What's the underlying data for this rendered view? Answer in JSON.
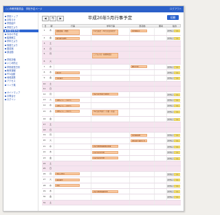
{
  "topbar": {
    "title": "○○市教育委員会　学校予定ページ",
    "right": "ログアウト"
  },
  "sidebar": {
    "groups": [
      {
        "items": [
          {
            "label": "学校トップ"
          },
          {
            "label": "お知らせ"
          },
          {
            "label": "学校紹介"
          },
          {
            "label": "学校だより"
          },
          {
            "label": "年間行事予定",
            "active": true
          },
          {
            "label": "今月の予定"
          },
          {
            "label": "給食献立"
          },
          {
            "label": "学年だより"
          },
          {
            "label": "保健だより"
          },
          {
            "label": "図書館"
          },
          {
            "label": "部活動"
          }
        ]
      },
      {
        "items": [
          {
            "label": "学校評価"
          },
          {
            "label": "いじめ防止"
          },
          {
            "label": "学校経営方針"
          },
          {
            "label": "教育課程"
          },
          {
            "label": "PTA活動"
          },
          {
            "label": "地域連携"
          },
          {
            "label": "アクセス"
          },
          {
            "label": "リンク集"
          }
        ]
      },
      {
        "items": [
          {
            "label": "サイトマップ"
          },
          {
            "label": "お問合せ"
          },
          {
            "label": "ログイン"
          }
        ]
      }
    ]
  },
  "nav": {
    "prev": "◀",
    "today": "今",
    "next": "▶"
  },
  "title": "平成26年5月行事予定",
  "print_button": "印刷",
  "columns": [
    "日",
    "曜",
    "行事",
    "学年行事",
    "部活動",
    "備考",
    "給食"
  ],
  "rows": [
    {
      "day": "1",
      "dow": "木",
      "type": "weekday",
      "events": [
        {
          "col": 2,
          "text": "避難訓練（地震）",
          "lines": 2
        },
        {
          "col": 3,
          "text": "1年生遠足・2年生社会科見学",
          "lines": 2
        },
        {
          "col": 4,
          "text": "部活動停止"
        }
      ],
      "tags": [
        {
          "col": 6,
          "text": "給食あり",
          "style": "g"
        },
        {
          "col": 6,
          "text": "牛乳",
          "style": "y",
          "offset": 1
        }
      ]
    },
    {
      "day": "2",
      "dow": "金",
      "type": "weekday",
      "events": [
        {
          "col": 2,
          "text": "教育相談週間"
        }
      ],
      "tags": [
        {
          "col": 6,
          "text": "給食あり",
          "style": "g"
        },
        {
          "col": 6,
          "text": "牛乳",
          "style": "y",
          "offset": 1
        }
      ]
    },
    {
      "day": "3",
      "dow": "土",
      "type": "weekend",
      "events": [],
      "tags": []
    },
    {
      "day": "4",
      "dow": "日",
      "type": "weekend",
      "events": [],
      "tags": []
    },
    {
      "day": "5",
      "dow": "月",
      "type": "weekend",
      "events": [
        {
          "col": 3,
          "text": "こどもの日・振替休業日",
          "lines": 2
        }
      ],
      "tags": []
    },
    {
      "day": "6",
      "dow": "火",
      "type": "weekend",
      "events": [],
      "tags": []
    },
    {
      "day": "7",
      "dow": "水",
      "type": "weekday",
      "events": [
        {
          "col": 4,
          "text": "職員会議"
        }
      ],
      "tags": [
        {
          "col": 6,
          "text": "給食あり",
          "style": "g"
        },
        {
          "col": 6,
          "text": "牛乳",
          "style": "y",
          "offset": 1
        }
      ]
    },
    {
      "day": "8",
      "dow": "木",
      "type": "weekday",
      "events": [
        {
          "col": 2,
          "text": "委員会"
        }
      ],
      "tags": [
        {
          "col": 6,
          "text": "給食あり",
          "style": "g"
        },
        {
          "col": 6,
          "text": "牛乳",
          "style": "y",
          "offset": 1
        }
      ]
    },
    {
      "day": "9",
      "dow": "金",
      "type": "weekday",
      "events": [
        {
          "col": 2,
          "text": "生徒総会"
        }
      ],
      "tags": [
        {
          "col": 6,
          "text": "給食あり",
          "style": "g"
        },
        {
          "col": 6,
          "text": "牛乳",
          "style": "y",
          "offset": 1
        }
      ]
    },
    {
      "day": "10",
      "dow": "土",
      "type": "weekend",
      "events": [],
      "tags": []
    },
    {
      "day": "11",
      "dow": "日",
      "type": "weekend",
      "events": [],
      "tags": []
    },
    {
      "day": "12",
      "dow": "月",
      "type": "weekday",
      "events": [
        {
          "col": 3,
          "text": "3年生修学旅行説明会"
        }
      ],
      "tags": [
        {
          "col": 6,
          "text": "給食あり",
          "style": "g"
        },
        {
          "col": 6,
          "text": "牛乳",
          "style": "y",
          "offset": 1
        }
      ]
    },
    {
      "day": "13",
      "dow": "火",
      "type": "weekday",
      "events": [
        {
          "col": 2,
          "text": "中間テスト（1日目）"
        }
      ],
      "tags": [
        {
          "col": 6,
          "text": "給食あり",
          "style": "g"
        },
        {
          "col": 6,
          "text": "牛乳",
          "style": "y",
          "offset": 1
        }
      ]
    },
    {
      "day": "14",
      "dow": "水",
      "type": "weekday",
      "events": [
        {
          "col": 2,
          "text": "中間テスト（2日目）"
        }
      ],
      "tags": [
        {
          "col": 6,
          "text": "給食あり",
          "style": "g"
        },
        {
          "col": 6,
          "text": "牛乳",
          "style": "y",
          "offset": 1
        }
      ]
    },
    {
      "day": "15",
      "dow": "木",
      "type": "weekday",
      "events": [
        {
          "col": 2,
          "text": "中間テスト（3日目）"
        },
        {
          "col": 3,
          "text": "3年生修学旅行（京都・奈良）",
          "lines": 2
        }
      ],
      "tags": [
        {
          "col": 6,
          "text": "給食あり",
          "style": "g"
        },
        {
          "col": 6,
          "text": "牛乳",
          "style": "y",
          "offset": 1
        }
      ]
    },
    {
      "day": "16",
      "dow": "金",
      "type": "weekday",
      "events": [],
      "tags": [
        {
          "col": 6,
          "text": "給食あり",
          "style": "g"
        },
        {
          "col": 6,
          "text": "牛乳",
          "style": "y",
          "offset": 1
        }
      ]
    },
    {
      "day": "17",
      "dow": "土",
      "type": "weekend",
      "events": [],
      "tags": []
    },
    {
      "day": "18",
      "dow": "日",
      "type": "weekend",
      "events": [],
      "tags": []
    },
    {
      "day": "19",
      "dow": "月",
      "type": "weekday",
      "events": [
        {
          "col": 4,
          "text": "部活動再開"
        }
      ],
      "tags": [
        {
          "col": 6,
          "text": "給食あり",
          "style": "g"
        },
        {
          "col": 6,
          "text": "牛乳",
          "style": "y",
          "offset": 1
        }
      ]
    },
    {
      "day": "20",
      "dow": "火",
      "type": "weekday",
      "events": [
        {
          "col": 4,
          "text": "地区総合体育大会"
        }
      ],
      "tags": [
        {
          "col": 6,
          "text": "給食あり",
          "style": "g"
        },
        {
          "col": 6,
          "text": "牛乳",
          "style": "y",
          "offset": 1
        }
      ]
    },
    {
      "day": "21",
      "dow": "水",
      "type": "weekday",
      "events": [
        {
          "col": 3,
          "text": "2年生職場体験事前指導"
        }
      ],
      "tags": [
        {
          "col": 6,
          "text": "給食あり",
          "style": "g"
        },
        {
          "col": 6,
          "text": "牛乳",
          "style": "y",
          "offset": 1
        }
      ]
    },
    {
      "day": "22",
      "dow": "木",
      "type": "weekday",
      "events": [
        {
          "col": 3,
          "text": "1年生宿泊学習"
        }
      ],
      "tags": [
        {
          "col": 6,
          "text": "給食あり",
          "style": "g"
        },
        {
          "col": 6,
          "text": "牛乳",
          "style": "y",
          "offset": 1
        }
      ]
    },
    {
      "day": "23",
      "dow": "金",
      "type": "weekday",
      "events": [
        {
          "col": 3,
          "text": "1年生宿泊学習"
        }
      ],
      "tags": [
        {
          "col": 6,
          "text": "給食あり",
          "style": "g"
        },
        {
          "col": 6,
          "text": "牛乳",
          "style": "y",
          "offset": 1
        }
      ]
    },
    {
      "day": "24",
      "dow": "土",
      "type": "weekend",
      "events": [],
      "tags": []
    },
    {
      "day": "25",
      "dow": "日",
      "type": "weekend",
      "events": [],
      "tags": []
    },
    {
      "day": "26",
      "dow": "月",
      "type": "weekday",
      "events": [
        {
          "col": 2,
          "text": "学校公開日"
        }
      ],
      "tags": [
        {
          "col": 6,
          "text": "給食あり",
          "style": "g"
        },
        {
          "col": 6,
          "text": "牛乳",
          "style": "y",
          "offset": 1
        }
      ]
    },
    {
      "day": "27",
      "dow": "火",
      "type": "weekday",
      "events": [
        {
          "col": 2,
          "text": "歯科検診"
        }
      ],
      "tags": [
        {
          "col": 6,
          "text": "給食あり",
          "style": "g"
        },
        {
          "col": 6,
          "text": "牛乳",
          "style": "y",
          "offset": 1
        }
      ]
    },
    {
      "day": "28",
      "dow": "水",
      "type": "weekday",
      "events": [
        {
          "col": 2,
          "text": "内科"
        }
      ],
      "tags": [
        {
          "col": 6,
          "text": "給食あり",
          "style": "g"
        },
        {
          "col": 6,
          "text": "牛乳",
          "style": "y",
          "offset": 1
        }
      ]
    },
    {
      "day": "29",
      "dow": "木",
      "type": "weekday",
      "events": [
        {
          "col": 3,
          "text": "2年生職場体験学習"
        }
      ],
      "tags": [
        {
          "col": 6,
          "text": "給食あり",
          "style": "g"
        },
        {
          "col": 6,
          "text": "牛乳",
          "style": "y",
          "offset": 1
        }
      ]
    },
    {
      "day": "30",
      "dow": "金",
      "type": "weekday",
      "events": [],
      "tags": [
        {
          "col": 6,
          "text": "給食あり",
          "style": "g"
        },
        {
          "col": 6,
          "text": "牛乳",
          "style": "y",
          "offset": 1
        }
      ]
    },
    {
      "day": "31",
      "dow": "土",
      "type": "weekend",
      "events": [],
      "tags": []
    }
  ]
}
